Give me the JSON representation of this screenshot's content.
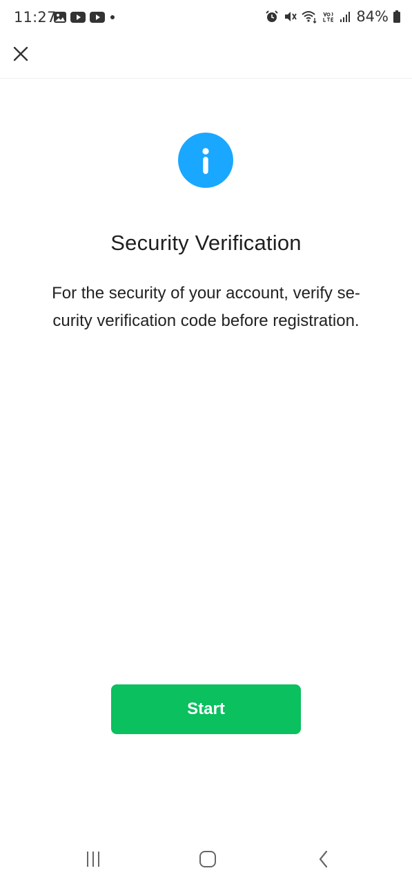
{
  "status_bar": {
    "time": "11:27",
    "battery": "84%",
    "left_icons": [
      "gallery-icon",
      "youtube-icon",
      "youtube-icon",
      "dot-icon"
    ],
    "right_icons": [
      "alarm-icon",
      "mute-icon",
      "wifi-icon",
      "volte-icon",
      "signal-icon",
      "battery-icon"
    ]
  },
  "header": {
    "close_icon": "close-icon"
  },
  "main": {
    "icon": "info-icon",
    "icon_color": "#1aa7ff",
    "title": "Security Verification",
    "description": "For the security of your account, verify se-curity verification code before registration."
  },
  "actions": {
    "start_label": "Start",
    "start_color": "#0ac05f"
  },
  "nav_bar": {
    "icons": [
      "recent-apps-icon",
      "home-icon",
      "back-icon"
    ]
  }
}
